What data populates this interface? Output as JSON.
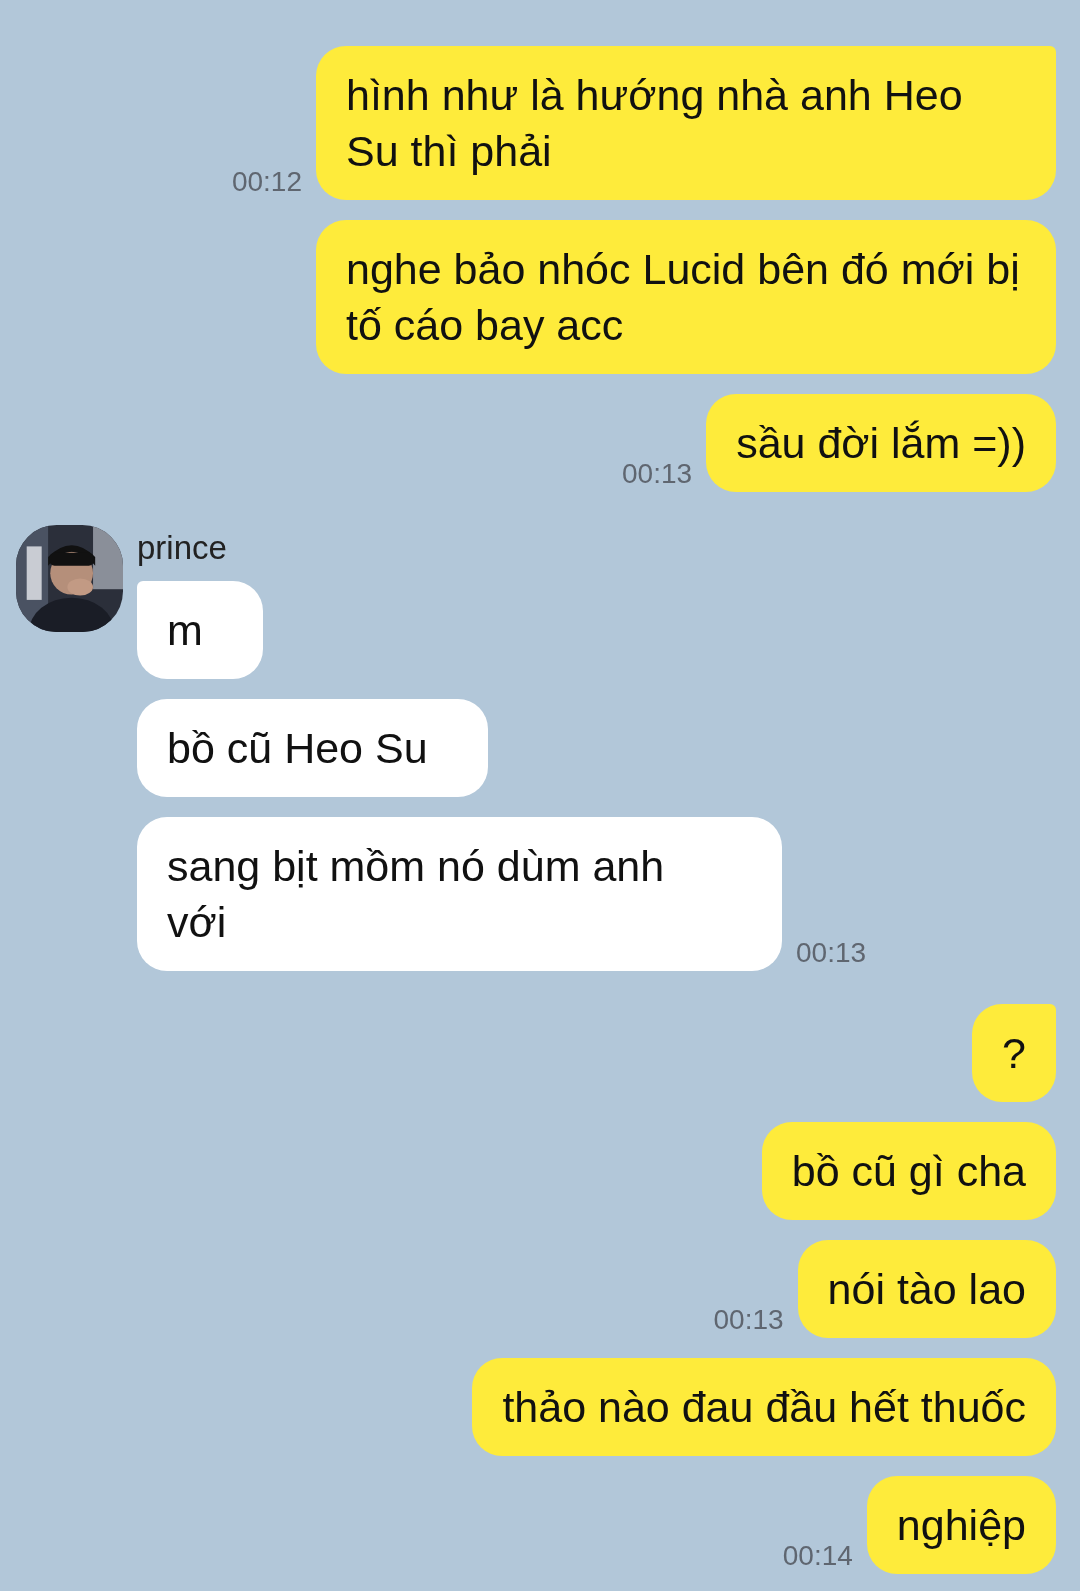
{
  "groups": [
    {
      "kind": "outgoing",
      "messages": [
        {
          "text": "hình như là hướng nhà anh Heo Su thì phải",
          "time": "00:12"
        },
        {
          "text": "nghe bảo nhóc Lucid bên đó mới bị tố cáo bay acc"
        },
        {
          "text": "sầu đời lắm =))",
          "time": "00:13"
        }
      ]
    },
    {
      "kind": "incoming",
      "sender": "prince",
      "messages": [
        {
          "text": "m"
        },
        {
          "text": "bồ cũ Heo Su"
        },
        {
          "text": "sang bịt mồm nó dùm anh với",
          "time": "00:13"
        }
      ]
    },
    {
      "kind": "outgoing",
      "messages": [
        {
          "text": "?"
        },
        {
          "text": "bồ cũ gì cha"
        },
        {
          "text": "nói tào lao",
          "time": "00:13"
        },
        {
          "text": "thảo nào đau đầu hết thuốc"
        },
        {
          "text": "nghiệp",
          "time": "00:14"
        }
      ]
    }
  ]
}
